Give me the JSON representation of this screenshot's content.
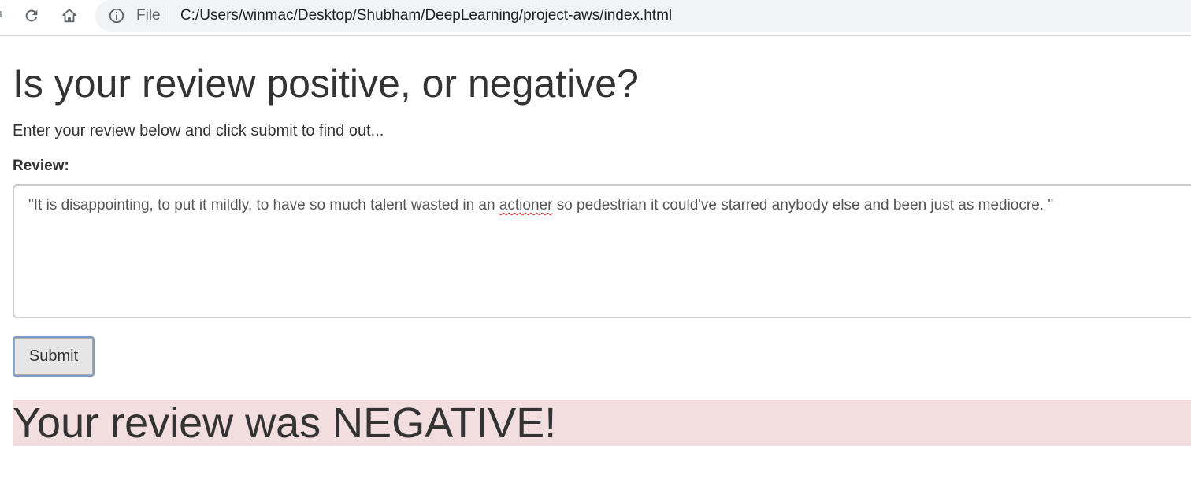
{
  "browser": {
    "scheme_label": "File",
    "url": "C:/Users/winmac/Desktop/Shubham/DeepLearning/project-aws/index.html"
  },
  "page": {
    "title": "Is your review positive, or negative?",
    "subtitle": "Enter your review below and click submit to find out...",
    "review_label": "Review:",
    "review": {
      "before": "\"It is disappointing, to put it mildly, to have so much talent wasted in an ",
      "misspelled": "actioner",
      "after": " so pedestrian it could've starred anybody else and been just as mediocre. \""
    },
    "submit_label": "Submit",
    "result": "Your review was NEGATIVE!"
  },
  "colors": {
    "result_background": "#f2dede",
    "text": "#333333",
    "button_focus_border": "#7f9cc7"
  },
  "icons": [
    "reload-icon",
    "home-icon",
    "info-icon"
  ]
}
